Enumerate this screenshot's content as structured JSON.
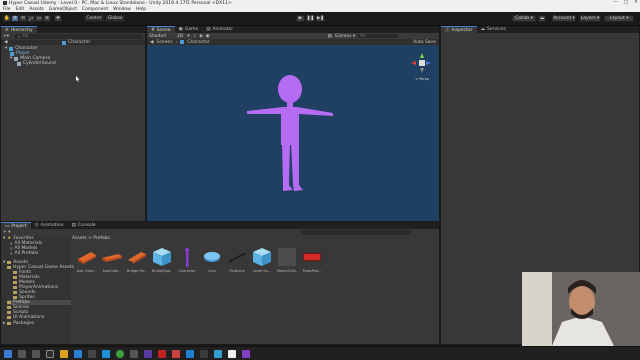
{
  "window": {
    "title": "Hyper Casual Udemy - Level 0 - PC, Mac & Linux Standalone - Unity 2019.4.17f1 Personal <DX11>",
    "min": "—",
    "max": "□",
    "close": "✕"
  },
  "menu": [
    "File",
    "Edit",
    "Assets",
    "GameObject",
    "Component",
    "Window",
    "Help"
  ],
  "toolbar": {
    "pivot": "Center",
    "space": "Global",
    "collab": "Collab ▾",
    "account": "Account ▾",
    "layers": "Layers ▾",
    "layout": "Layout ▾"
  },
  "hierarchy": {
    "tab": "Hierarchy",
    "search_placeholder": "All",
    "scene_title": "Character",
    "items": [
      "Character",
      "Player",
      "Main Camera",
      "CylinderSound"
    ]
  },
  "scene": {
    "tabs": [
      "Scene",
      "Game",
      "Animator"
    ],
    "shading": "Shaded",
    "gizmos": "Gizmos ▾",
    "search_placeholder": "All",
    "breadcrumb_scenes": "Scenes",
    "breadcrumb_object": "Character",
    "autosave": "Auto Save",
    "persp": "< Persp"
  },
  "colors": {
    "scene_bg": "#1f3f63",
    "character": "#b56cf2",
    "accent": "#4a7fcf"
  },
  "inspector": {
    "tabs": [
      "Inspector",
      "Services"
    ]
  },
  "project": {
    "tabs": [
      "Project",
      "Animation",
      "Console"
    ],
    "create": "+ ▾",
    "breadcrumb": "Assets > Prefabs",
    "favorites_label": "Favorites",
    "favorites": [
      "All Materials",
      "All Models",
      "All Prefabs"
    ],
    "assets_label": "Assets",
    "tree": [
      "Hyper Casual Game Assets",
      "Fonts",
      "Materials",
      "Models",
      "PlayerAnimations",
      "Sounds",
      "Sprites",
      "Prefabs",
      "Scenes",
      "Scripts",
      "UI Animations"
    ],
    "packages_label": "Packages",
    "assets": [
      {
        "label": "Axe Cube...",
        "icon": "orange-block-icon"
      },
      {
        "label": "AxeCube...",
        "icon": "orange-block-icon"
      },
      {
        "label": "Bridge Pie...",
        "icon": "orange-block-icon"
      },
      {
        "label": "BridgeSpa...",
        "icon": "blue-cube-icon"
      },
      {
        "label": "Character",
        "icon": "purple-character-icon"
      },
      {
        "label": "Coin",
        "icon": "blue-coin-icon"
      },
      {
        "label": "FinalLine",
        "icon": "dark-bar-icon"
      },
      {
        "label": "Level Sp...",
        "icon": "blue-cube-icon"
      },
      {
        "label": "MainpCylin...",
        "icon": "grey-cylinder-icon"
      },
      {
        "label": "TrapsProf...",
        "icon": "red-trap-icon"
      }
    ]
  }
}
